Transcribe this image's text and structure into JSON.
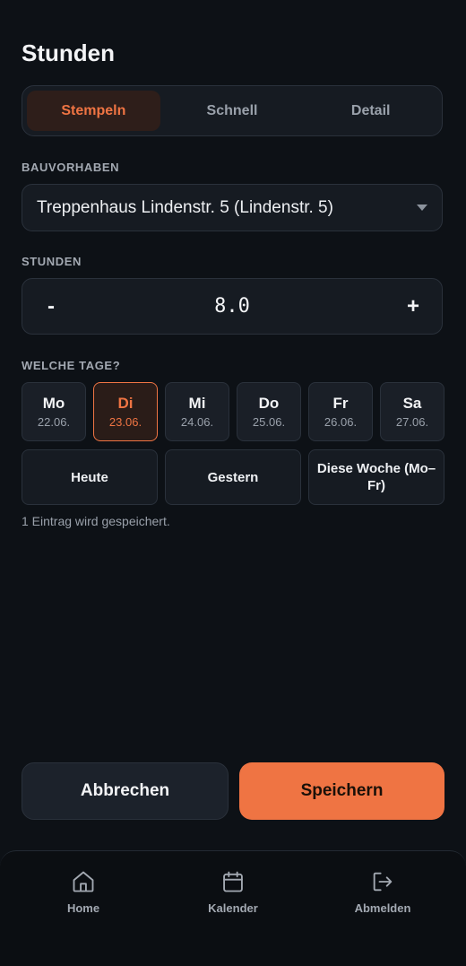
{
  "page": {
    "title": "Stunden"
  },
  "modes": [
    {
      "label": "Stempeln",
      "active": true
    },
    {
      "label": "Schnell",
      "active": false
    },
    {
      "label": "Detail",
      "active": false
    }
  ],
  "project": {
    "label": "BAUVORHABEN",
    "value": "Treppenhaus Lindenstr. 5 (Lindenstr. 5)"
  },
  "hours": {
    "label": "STUNDEN",
    "minus": "-",
    "value": "8.0",
    "plus": "+"
  },
  "days": {
    "label": "WELCHE TAGE?",
    "items": [
      {
        "name": "Mo",
        "date": "22.06.",
        "selected": false
      },
      {
        "name": "Di",
        "date": "23.06.",
        "selected": true
      },
      {
        "name": "Mi",
        "date": "24.06.",
        "selected": false
      },
      {
        "name": "Do",
        "date": "25.06.",
        "selected": false
      },
      {
        "name": "Fr",
        "date": "26.06.",
        "selected": false
      },
      {
        "name": "Sa",
        "date": "27.06.",
        "selected": false
      }
    ],
    "quick": [
      "Heute",
      "Gestern",
      "Diese Woche (Mo–Fr)"
    ]
  },
  "summary": "1 Eintrag wird gespeichert.",
  "actions": {
    "cancel": "Abbrechen",
    "save": "Speichern"
  },
  "nav": [
    {
      "label": "Home",
      "icon": "home-icon"
    },
    {
      "label": "Kalender",
      "icon": "calendar-icon"
    },
    {
      "label": "Abmelden",
      "icon": "logout-icon"
    }
  ],
  "colors": {
    "accent": "#ef7443",
    "background": "#0d1116",
    "surface": "#161b22"
  }
}
